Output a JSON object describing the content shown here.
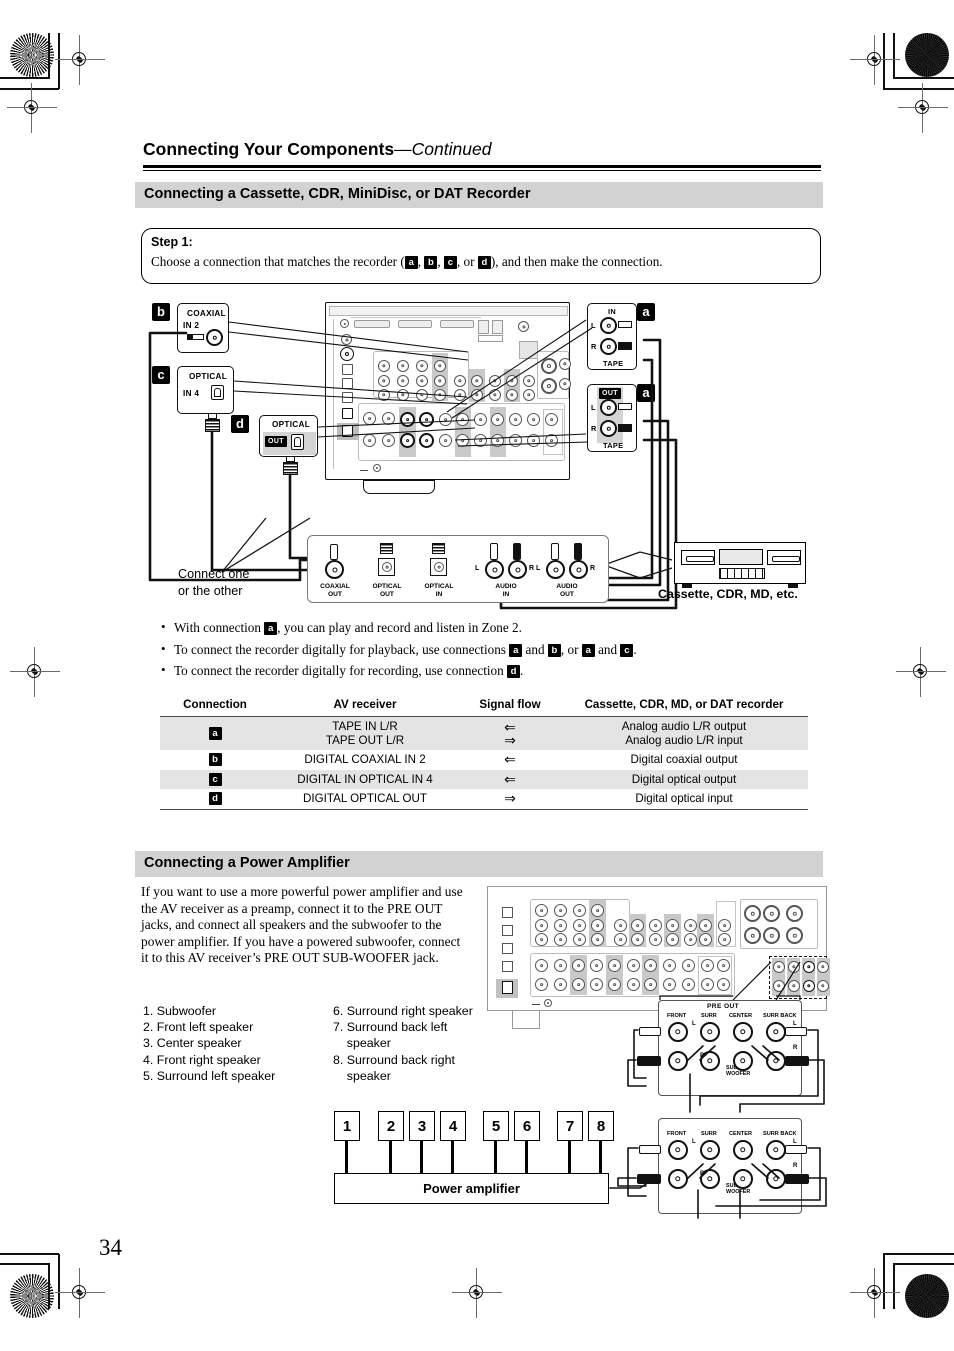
{
  "page": {
    "number": "34",
    "title_main": "Connecting Your Components",
    "title_cont": "—Continued"
  },
  "section1": {
    "heading": "Connecting a Cassette, CDR, MiniDisc, or DAT Recorder",
    "step": {
      "label": "Step 1:",
      "text_pre": "Choose a connection that matches the recorder (",
      "chips": [
        "a",
        "b",
        "c",
        "d"
      ],
      "text_post": "), and then make the connection.",
      "sep": ", ",
      "or": ", or "
    },
    "bullets": [
      {
        "pre": "With connection ",
        "chips": [
          "a"
        ],
        "post": ", you can play and record and listen in Zone 2."
      },
      {
        "pre": "To connect the recorder digitally for playback, use connections ",
        "chips": [
          "a",
          "b",
          "a",
          "c"
        ],
        "post": "."
      },
      {
        "pre": "To connect the recorder digitally for recording, use connection ",
        "chips": [
          "d"
        ],
        "post": "."
      }
    ],
    "bullet2_joiners": [
      " and ",
      ", or ",
      " and "
    ],
    "diagram": {
      "callout_b": {
        "chip": "b",
        "line1": "COAXIAL",
        "line2": "IN 2"
      },
      "callout_c": {
        "chip": "c",
        "line1": "OPTICAL",
        "line2": "IN 4"
      },
      "callout_d": {
        "chip": "d",
        "line1": "OPTICAL",
        "badge": "OUT"
      },
      "callout_a_in": {
        "chip": "a",
        "top": "IN",
        "left_l": "L",
        "left_r": "R",
        "bottom": "TAPE"
      },
      "callout_a_out": {
        "chip": "a",
        "badge": "OUT",
        "left_l": "L",
        "left_r": "R",
        "bottom": "TAPE"
      },
      "connect_note_l1": "Connect one",
      "connect_note_l2": "or the other",
      "recorder_jacks": [
        {
          "l1": "COAXIAL",
          "l2": "OUT"
        },
        {
          "l1": "OPTICAL",
          "l2": "OUT"
        },
        {
          "l1": "OPTICAL",
          "l2": "IN"
        },
        {
          "l1": "AUDIO",
          "l2": "IN",
          "lr": [
            "L",
            "R"
          ]
        },
        {
          "l1": "AUDIO",
          "l2": "OUT",
          "lr": [
            "L",
            "R"
          ]
        }
      ],
      "device_caption": "Cassette, CDR, MD, etc."
    },
    "table": {
      "headers": [
        "Connection",
        "AV receiver",
        "Signal flow",
        "Cassette, CDR, MD, or DAT recorder"
      ],
      "rows": [
        {
          "chip": "a",
          "receiver": [
            "TAPE IN L/R",
            "TAPE OUT L/R"
          ],
          "flow": [
            "⇐",
            "⇒"
          ],
          "recorder": [
            "Analog audio L/R output",
            "Analog audio L/R input"
          ],
          "shaded": true
        },
        {
          "chip": "b",
          "receiver": [
            "DIGITAL COAXIAL IN 2"
          ],
          "flow": [
            "⇐"
          ],
          "recorder": [
            "Digital coaxial output"
          ],
          "shaded": false
        },
        {
          "chip": "c",
          "receiver": [
            "DIGITAL IN OPTICAL IN 4"
          ],
          "flow": [
            "⇐"
          ],
          "recorder": [
            "Digital optical output"
          ],
          "shaded": true
        },
        {
          "chip": "d",
          "receiver": [
            "DIGITAL OPTICAL OUT"
          ],
          "flow": [
            "⇒"
          ],
          "recorder": [
            "Digital optical input"
          ],
          "shaded": false
        }
      ]
    }
  },
  "section2": {
    "heading": "Connecting a Power Amplifier",
    "body": "If you want to use a more powerful power amplifier and use the AV receiver as a preamp, connect it to the PRE OUT jacks, and connect all speakers and the subwoofer to the power amplifier. If you have a powered subwoofer, connect it to this AV receiver’s PRE OUT SUB-WOOFER jack.",
    "speakers_col1": [
      "1. Subwoofer",
      "2. Front left speaker",
      "3. Center speaker",
      "4. Front right speaker",
      "5. Surround left speaker"
    ],
    "speakers_col2": [
      "6. Surround right speaker",
      "7. Surround back left",
      "    speaker",
      "8. Surround back right",
      "    speaker"
    ],
    "numbers": [
      "1",
      "2",
      "3",
      "4",
      "5",
      "6",
      "7",
      "8"
    ],
    "amp_label": "Power amplifier",
    "preout": {
      "title": "PRE OUT",
      "labels": [
        "FRONT",
        "SURR",
        "CENTER",
        "SURR BACK"
      ],
      "lr": [
        "L",
        "R"
      ],
      "sub_l1": "SUB",
      "sub_l2": "WOOFER"
    }
  },
  "colors": {
    "band_gray": "#d2d2d2",
    "row_shade": "#e4e4e4",
    "panel_gray": "#c9c9c9",
    "ink": "#000000"
  }
}
